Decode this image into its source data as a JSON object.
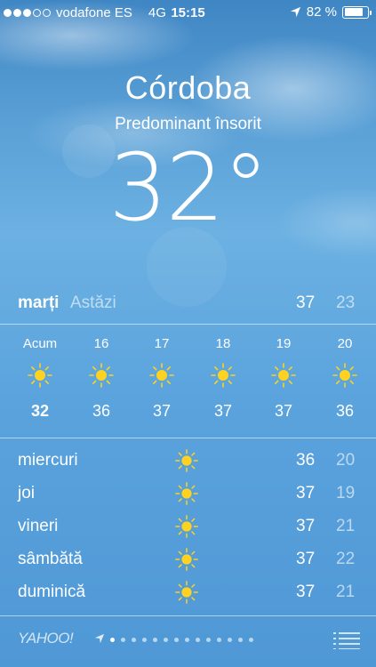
{
  "status_bar": {
    "carrier": "vodafone ES",
    "network": "4G",
    "time": "15:15",
    "battery": "82 %",
    "battery_level": 0.82,
    "signal_bars_filled": 3,
    "signal_bars_total": 5,
    "location_icon": "location-arrow-icon"
  },
  "current": {
    "city": "Córdoba",
    "condition": "Predominant însorit",
    "temperature": "32°"
  },
  "today": {
    "day": "marți",
    "label": "Astăzi",
    "high": "37",
    "low": "23"
  },
  "hourly": [
    {
      "hour": "Acum",
      "temp": "32",
      "icon": "sun-icon"
    },
    {
      "hour": "16",
      "temp": "36",
      "icon": "sun-icon"
    },
    {
      "hour": "17",
      "temp": "37",
      "icon": "sun-icon"
    },
    {
      "hour": "18",
      "temp": "37",
      "icon": "sun-icon"
    },
    {
      "hour": "19",
      "temp": "37",
      "icon": "sun-icon"
    },
    {
      "hour": "20",
      "temp": "36",
      "icon": "sun-icon"
    }
  ],
  "forecast": [
    {
      "day": "miercuri",
      "high": "36",
      "low": "20",
      "icon": "sun-icon"
    },
    {
      "day": "joi",
      "high": "37",
      "low": "19",
      "icon": "sun-icon"
    },
    {
      "day": "vineri",
      "high": "37",
      "low": "21",
      "icon": "sun-icon"
    },
    {
      "day": "sâmbătă",
      "high": "37",
      "low": "22",
      "icon": "sun-icon"
    },
    {
      "day": "duminică",
      "high": "37",
      "low": "21",
      "icon": "sun-icon"
    }
  ],
  "footer": {
    "provider": "YAHOO!",
    "page_count": 14,
    "current_page": 1
  }
}
